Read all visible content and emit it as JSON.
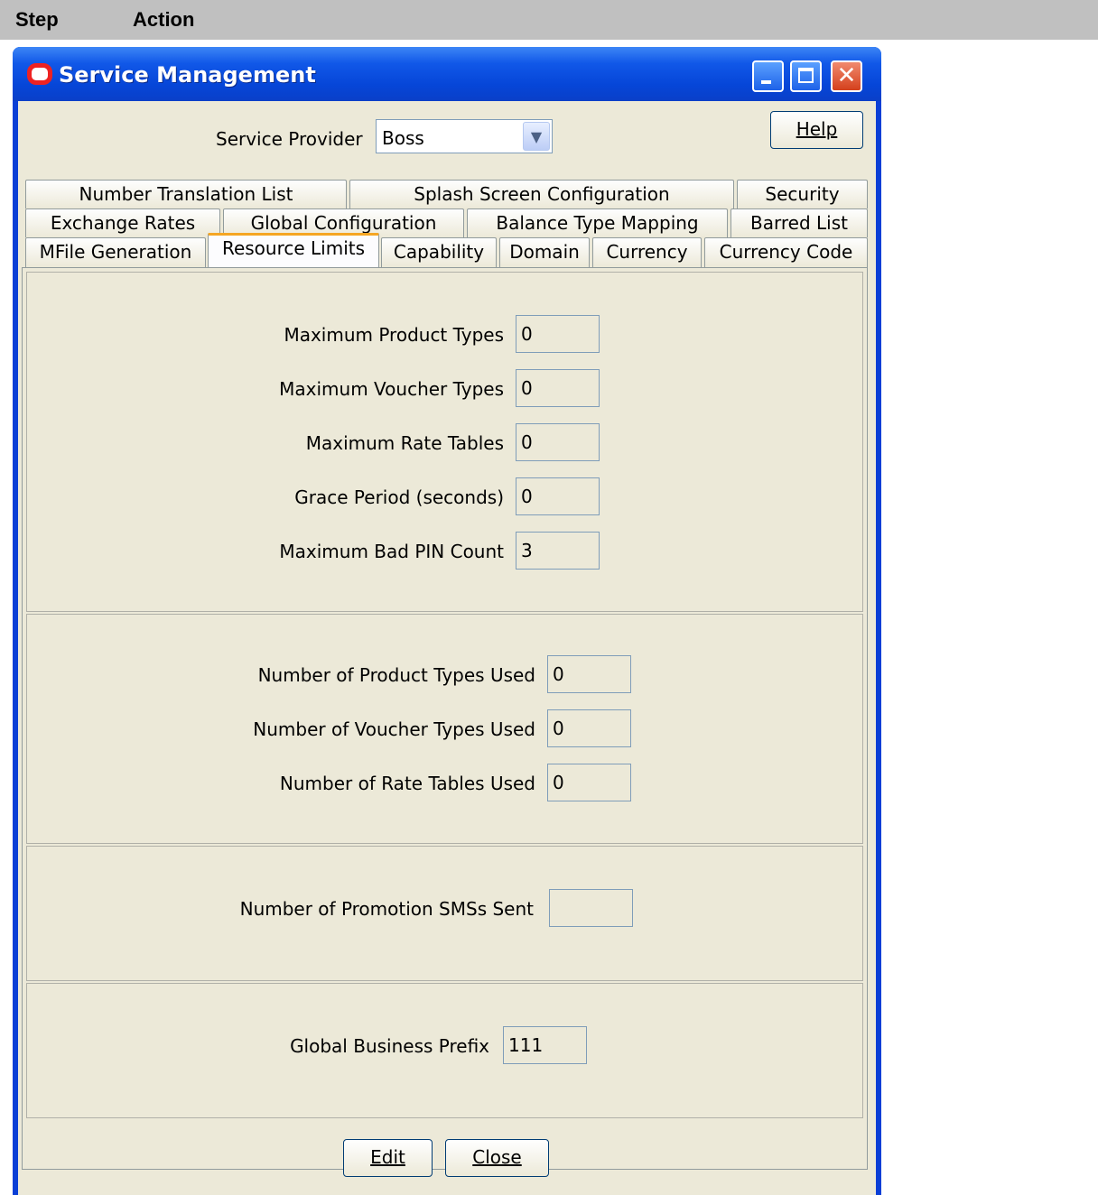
{
  "doc_header": {
    "step": "Step",
    "action": "Action"
  },
  "window": {
    "title": "Service Management",
    "controls": [
      "minimize-icon",
      "maximize-icon",
      "close-icon"
    ]
  },
  "service_provider": {
    "label": "Service Provider",
    "value": "Boss"
  },
  "help_button": "Help",
  "tabs": {
    "row1": [
      "Number Translation List",
      "Splash Screen Configuration",
      "Security"
    ],
    "row2": [
      "Exchange Rates",
      "Global Configuration",
      "Balance Type Mapping",
      "Barred List"
    ],
    "row3": [
      "MFile Generation",
      "Resource Limits",
      "Capability",
      "Domain",
      "Currency",
      "Currency Code"
    ],
    "active": "Resource Limits"
  },
  "limits": [
    {
      "label": "Maximum Product Types",
      "value": "0"
    },
    {
      "label": "Maximum Voucher Types",
      "value": "0"
    },
    {
      "label": "Maximum Rate Tables",
      "value": "0"
    },
    {
      "label": "Grace Period (seconds)",
      "value": "0"
    },
    {
      "label": "Maximum Bad PIN Count",
      "value": "3"
    }
  ],
  "usage": [
    {
      "label": "Number of Product Types Used",
      "value": "0"
    },
    {
      "label": "Number of Voucher Types Used",
      "value": "0"
    },
    {
      "label": "Number of Rate Tables Used",
      "value": "0"
    }
  ],
  "promotion": {
    "label": "Number of Promotion SMSs Sent",
    "value": ""
  },
  "business_prefix": {
    "label": "Global Business Prefix",
    "value": "111"
  },
  "buttons": {
    "edit": "Edit",
    "close": "Close"
  }
}
